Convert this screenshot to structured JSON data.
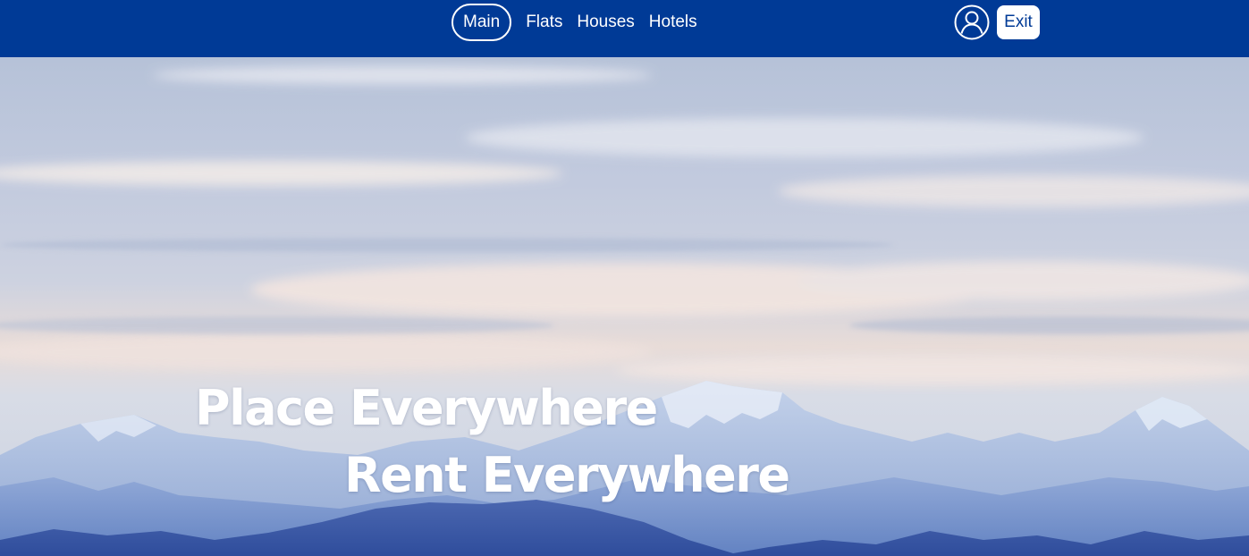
{
  "nav": {
    "links": [
      {
        "label": "Main",
        "active": true
      },
      {
        "label": "Flats",
        "active": false
      },
      {
        "label": "Houses",
        "active": false
      },
      {
        "label": "Hotels",
        "active": false
      }
    ],
    "user_icon": "user-circle-icon",
    "exit_label": "Exit"
  },
  "hero": {
    "line1": "Place Everywhere",
    "line2": "Rent Everywhere"
  },
  "colors": {
    "navbar": "#003a96",
    "text": "#ffffff"
  }
}
